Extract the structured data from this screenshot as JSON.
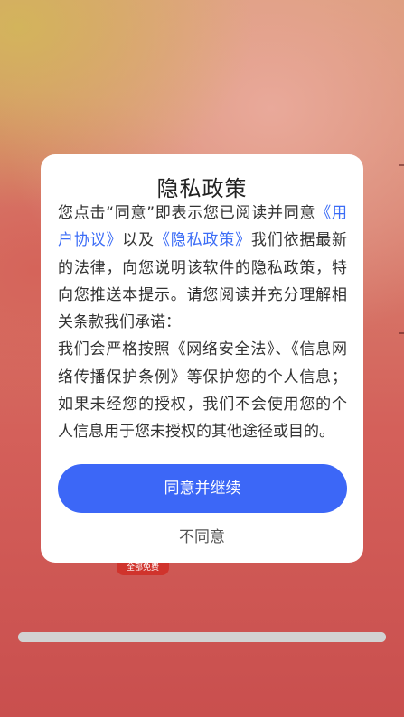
{
  "dialog": {
    "title": "隐私政策",
    "body_before_link1": "您点击“同意”即表示您已阅读并同意",
    "user_agreement_link": "《用户协议》",
    "body_and": "以及",
    "privacy_policy_link": "《隐私政策》",
    "body_after_links": "我们依据最新的法律，向您说明该软件的隐私政策，特向您推送本提示。请您阅读并充分理解相关条款我们承诺：",
    "body_commitment": "我们会严格按照《网络安全法》、《信息网络传播保护条例》等保护您的个人信息；如果未经您的授权，我们不会使用您的个人信息用于您未授权的其他途径或目的。",
    "agree_button_label": "同意并继续",
    "disagree_button_label": "不同意"
  },
  "background": {
    "free_badge_text": "全部免费",
    "progress_fraction": 1.0
  },
  "colors": {
    "accent": "#3c67f7",
    "link": "#3b6cf6",
    "badge": "#d0332c"
  }
}
